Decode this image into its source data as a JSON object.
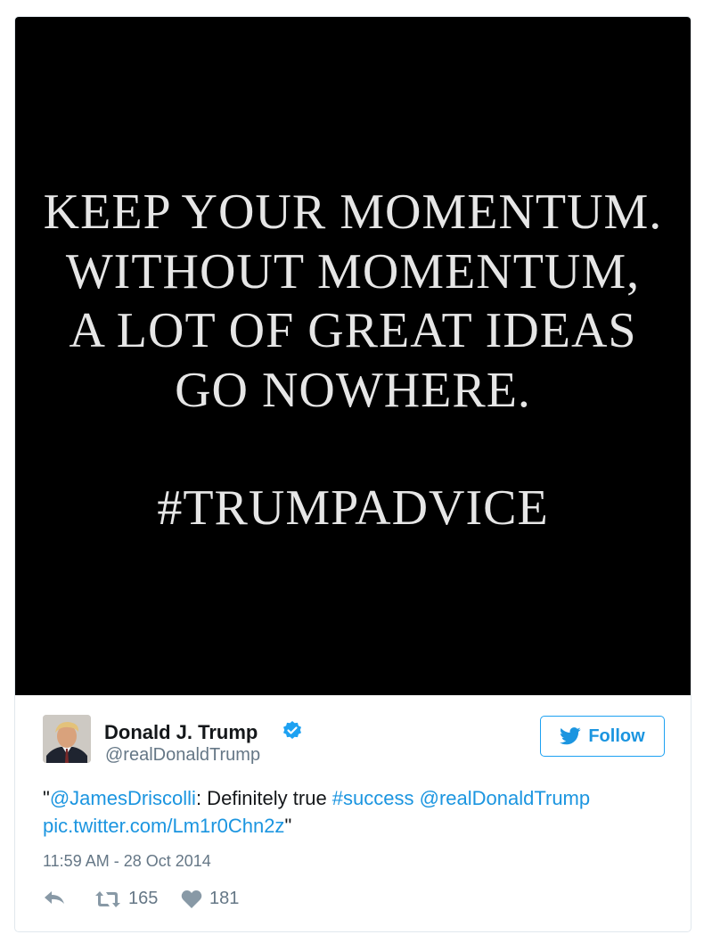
{
  "media": {
    "quote_lines": [
      "KEEP YOUR MOMENTUM.",
      "WITHOUT MOMENTUM,",
      "A LOT OF GREAT IDEAS",
      "GO NOWHERE."
    ],
    "hashtag": "#TRUMPADVICE"
  },
  "author": {
    "name": "Donald J. Trump",
    "handle": "@realDonaldTrump",
    "verified_icon": "verified-badge-icon",
    "verified_color": "#1da1f2"
  },
  "follow_button": {
    "label": "Follow",
    "icon": "twitter-bird-icon",
    "color": "#1b95e0"
  },
  "tweet": {
    "quote_open": "\"",
    "mention_1": "@JamesDriscolli",
    "text_1": ": Definitely true ",
    "hashtag": "#success",
    "space": " ",
    "mention_2": "@realDonaldTrump",
    "pic_link": "pic.twitter.com/Lm1r0Chn2z",
    "quote_close": "\"",
    "link_color": "#1b95e0"
  },
  "timestamp": "11:59 AM - 28 Oct 2014",
  "actions": {
    "reply_icon": "reply-icon",
    "retweet_icon": "retweet-icon",
    "retweet_count": "165",
    "like_icon": "heart-icon",
    "like_count": "181"
  }
}
